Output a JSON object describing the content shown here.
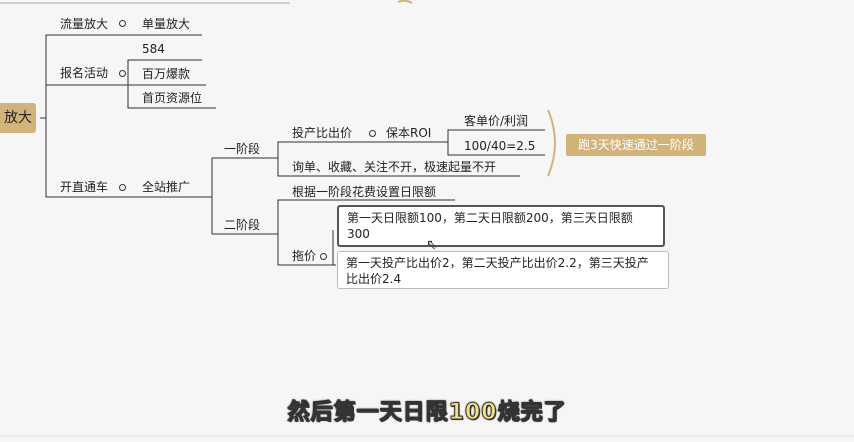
{
  "mindmap": {
    "root": "放大",
    "traffic": "流量放大",
    "single_amplify": "单量放大",
    "signup": "报名活动",
    "v584": "584",
    "million": "百万爆款",
    "homepage": "首页资源位",
    "open_train": "开直通车",
    "full_promo": "全站推广",
    "stage1": "一阶段",
    "roi_bid": "投产比出价",
    "keep_roi": "保本ROI",
    "aov": "客单价/利润",
    "calc": "100/40=2.5",
    "run3": "跑3天快速通过一阶段",
    "inquiry": "询单、收藏、关注不开，极速起量不开",
    "stage2": "二阶段",
    "set_limit": "根据一阶段花费设置日限额",
    "limit_text": "第一天日限额100，第二天日限额200，第三天日限额300",
    "raise_price": "拖价",
    "bid_text": "第一天投产比出价2，第二天投产比出价2.2，第三天投产比出价2.4"
  },
  "subtitle": "然后第一天日限100烧完了"
}
